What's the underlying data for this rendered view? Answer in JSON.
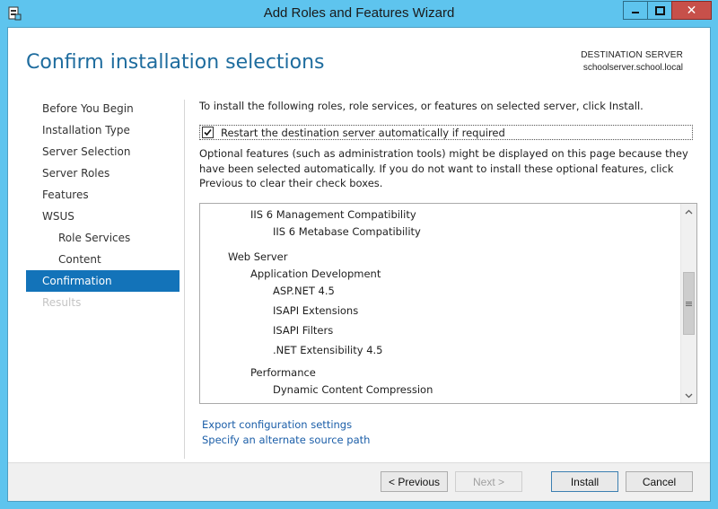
{
  "window": {
    "title": "Add Roles and Features Wizard",
    "caption_buttons": {
      "minimize": "—",
      "maximize": "□",
      "close": "✕"
    },
    "accent_color": "#5ec4ee"
  },
  "header": {
    "page_title": "Confirm installation selections",
    "destination_label": "DESTINATION SERVER",
    "destination_value": "schoolserver.school.local"
  },
  "nav": {
    "items": [
      {
        "label": "Before You Begin",
        "state": "normal"
      },
      {
        "label": "Installation Type",
        "state": "normal"
      },
      {
        "label": "Server Selection",
        "state": "normal"
      },
      {
        "label": "Server Roles",
        "state": "normal"
      },
      {
        "label": "Features",
        "state": "normal"
      },
      {
        "label": "WSUS",
        "state": "normal"
      },
      {
        "label": "Role Services",
        "state": "sub"
      },
      {
        "label": "Content",
        "state": "sub"
      },
      {
        "label": "Confirmation",
        "state": "active"
      },
      {
        "label": "Results",
        "state": "disabled"
      }
    ]
  },
  "main": {
    "intro": "To install the following roles, role services, or features on selected server, click Install.",
    "restart_checkbox": {
      "label": "Restart the destination server automatically if required",
      "checked": true
    },
    "optional_note": "Optional features (such as administration tools) might be displayed on this page because they have been selected automatically. If you do not want to install these optional features, click Previous to clear their check boxes.",
    "features": [
      "IIS 6 Management Compatibility",
      "IIS 6 Metabase Compatibility",
      "Web Server",
      "Application Development",
      "ASP.NET 4.5",
      "ISAPI Extensions",
      "ISAPI Filters",
      ".NET Extensibility 4.5",
      "Performance",
      "Dynamic Content Compression"
    ],
    "links": {
      "export": "Export configuration settings",
      "alternate_source": "Specify an alternate source path"
    }
  },
  "footer": {
    "previous": "< Previous",
    "next": "Next >",
    "install": "Install",
    "cancel": "Cancel"
  }
}
